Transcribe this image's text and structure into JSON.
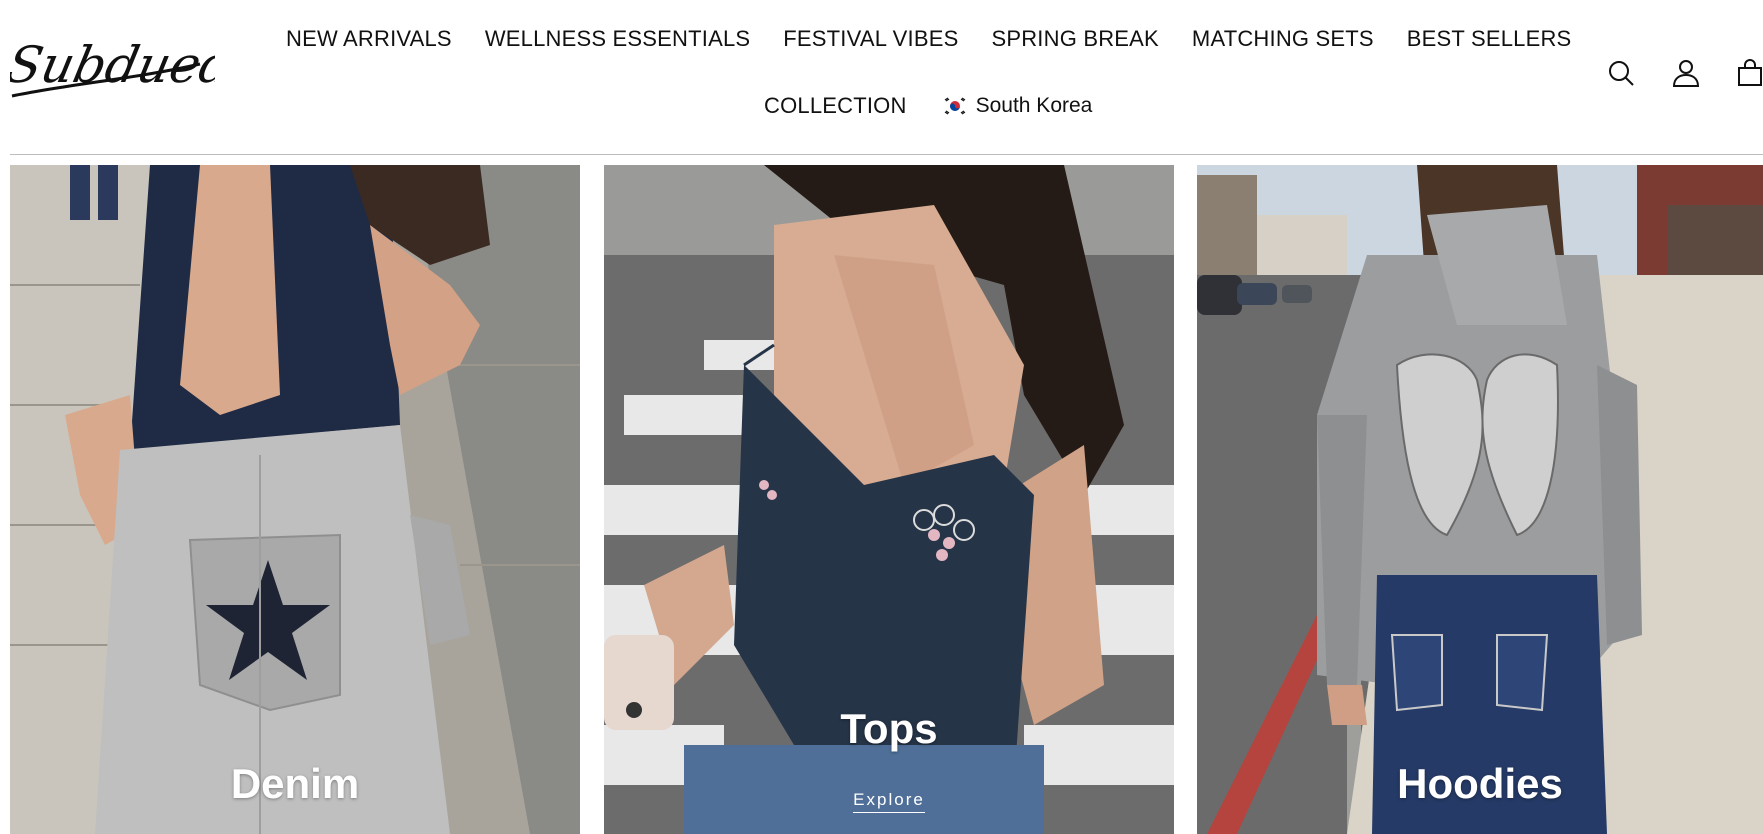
{
  "header": {
    "logo_text": "Subdued",
    "nav": [
      {
        "label": "NEW ARRIVALS"
      },
      {
        "label": "WELLNESS ESSENTIALS"
      },
      {
        "label": "FESTIVAL VIBES"
      },
      {
        "label": "SPRING BREAK"
      },
      {
        "label": "MATCHING SETS"
      },
      {
        "label": "BEST SELLERS"
      },
      {
        "label": "COLLECTION"
      }
    ],
    "country": {
      "label": "South Korea",
      "flag_icon": "south-korea-flag-icon"
    },
    "icons": [
      "search-icon",
      "account-icon",
      "cart-icon"
    ]
  },
  "tiles": [
    {
      "title": "Denim",
      "link": ""
    },
    {
      "title": "Tops",
      "link": "Explore"
    },
    {
      "title": "Hoodies",
      "link": ""
    }
  ]
}
